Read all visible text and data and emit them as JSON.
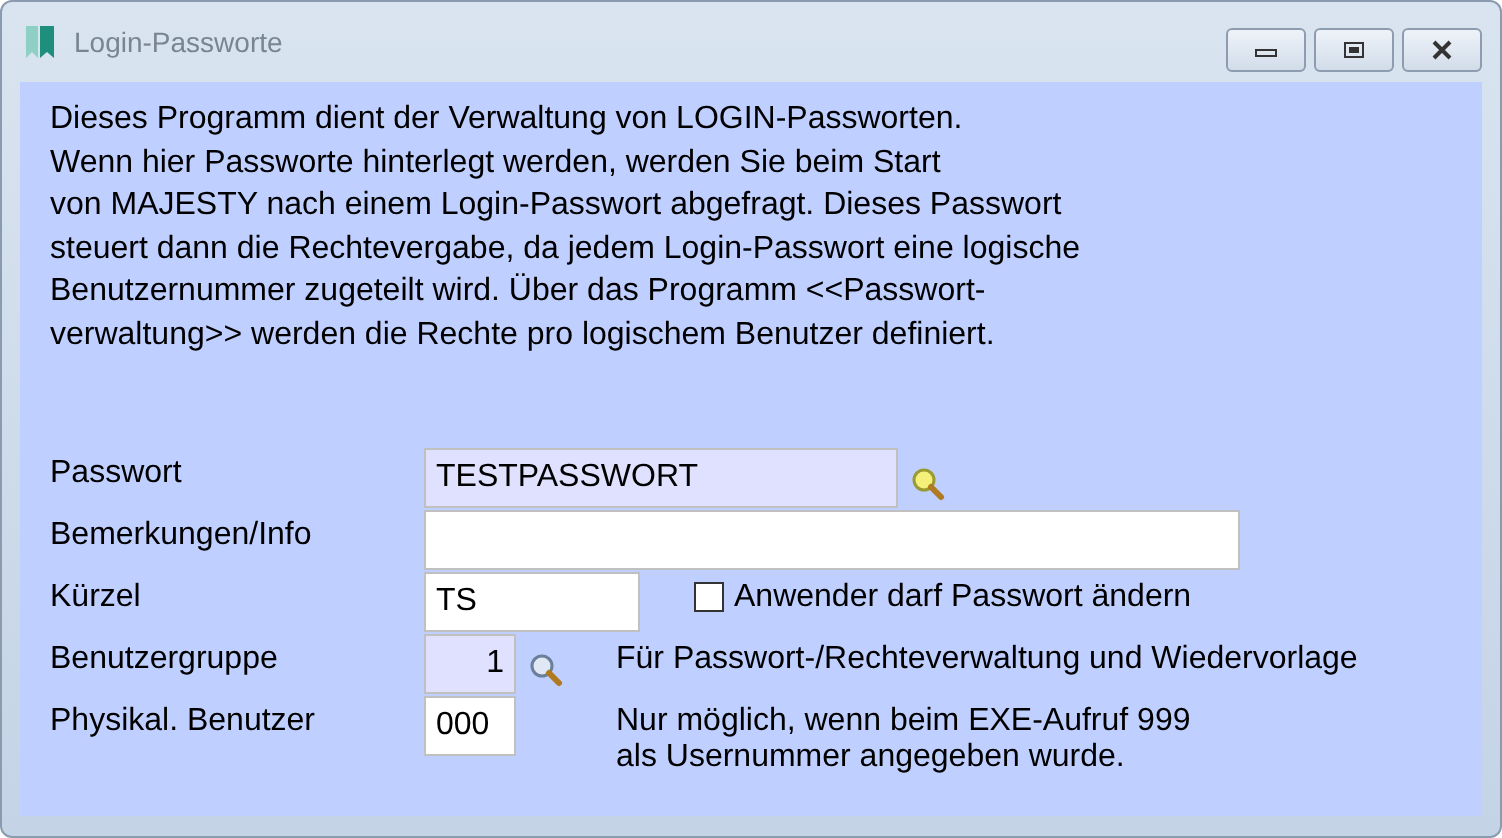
{
  "window": {
    "title": "Login-Passworte"
  },
  "description_lines": [
    "Dieses Programm dient der Verwaltung von LOGIN-Passworten.",
    "Wenn hier Passworte hinterlegt werden, werden Sie beim Start",
    "von MAJESTY nach einem Login-Passwort abgefragt. Dieses Passwort",
    "steuert dann die Rechtevergabe, da jedem Login-Passwort eine logische",
    "Benutzernummer zugeteilt wird. Über das Programm <<Passwort-",
    "verwaltung>> werden die Rechte pro logischem Benutzer definiert."
  ],
  "fields": [
    {
      "label": "Passwort",
      "value": "TESTPASSWORT",
      "kind": "key"
    },
    {
      "label": "Bemerkungen/Info",
      "kind": "text"
    },
    {
      "label": "Kürzel",
      "value": "TS",
      "kind": "text",
      "checkbox": {
        "label": "Anwender darf Passwort ändern",
        "checked": false
      }
    },
    {
      "label": "Benutzergruppe",
      "value": "1",
      "kind": "lookup",
      "note": "Für Passwort-/Rechteverwaltung und Wiedervorlage"
    },
    {
      "label": "Physikal. Benutzer",
      "value": "000",
      "kind": "text",
      "note": "Nur möglich, wenn beim EXE-Aufruf 999\nals Usernummer angegeben wurde."
    }
  ]
}
